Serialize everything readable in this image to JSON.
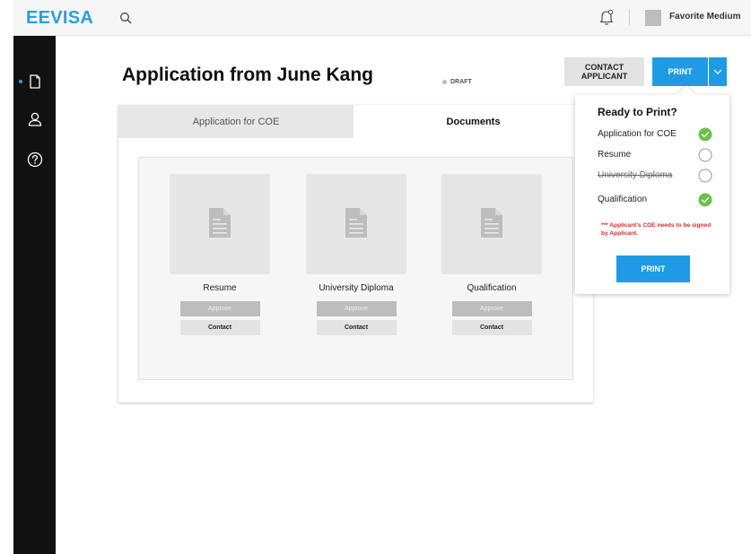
{
  "topbar": {
    "logo": "EEVISA",
    "user_name": "Favorite Medium"
  },
  "header": {
    "title": "Application from June Kang",
    "status": "DRAFT",
    "contact_label_line1": "CONTACT",
    "contact_label_line2": "APPLICANT",
    "print_label": "PRINT"
  },
  "tabs": [
    {
      "label": "Application for COE",
      "active": false
    },
    {
      "label": "Documents",
      "active": true
    }
  ],
  "documents": [
    {
      "name": "Resume",
      "approve": "Approve",
      "contact": "Contact"
    },
    {
      "name": "University Diploma",
      "approve": "Approve",
      "contact": "Contact"
    },
    {
      "name": "Qualification",
      "approve": "Approve",
      "contact": "Contact"
    }
  ],
  "ready": {
    "title": "Ready to Print?",
    "items": [
      {
        "label": "Application for COE",
        "done": true,
        "struck": false
      },
      {
        "label": "Resume",
        "done": false,
        "struck": false
      },
      {
        "label": "University Diploma",
        "done": false,
        "struck": true
      },
      {
        "label": "Qualification",
        "done": true,
        "struck": false
      }
    ],
    "warning": "*** Applicant's COE needs to be signed by Applicant.",
    "print_label": "PRINT"
  },
  "colors": {
    "accent": "#1e9be4",
    "check_green": "#6cc04a",
    "warning_red": "#d42b2b",
    "sidebar": "#111111"
  },
  "icons": [
    "search-icon",
    "bell-icon",
    "document-icon",
    "user-icon",
    "help-icon",
    "chevron-down-icon",
    "check-icon",
    "empty-circle-icon"
  ]
}
